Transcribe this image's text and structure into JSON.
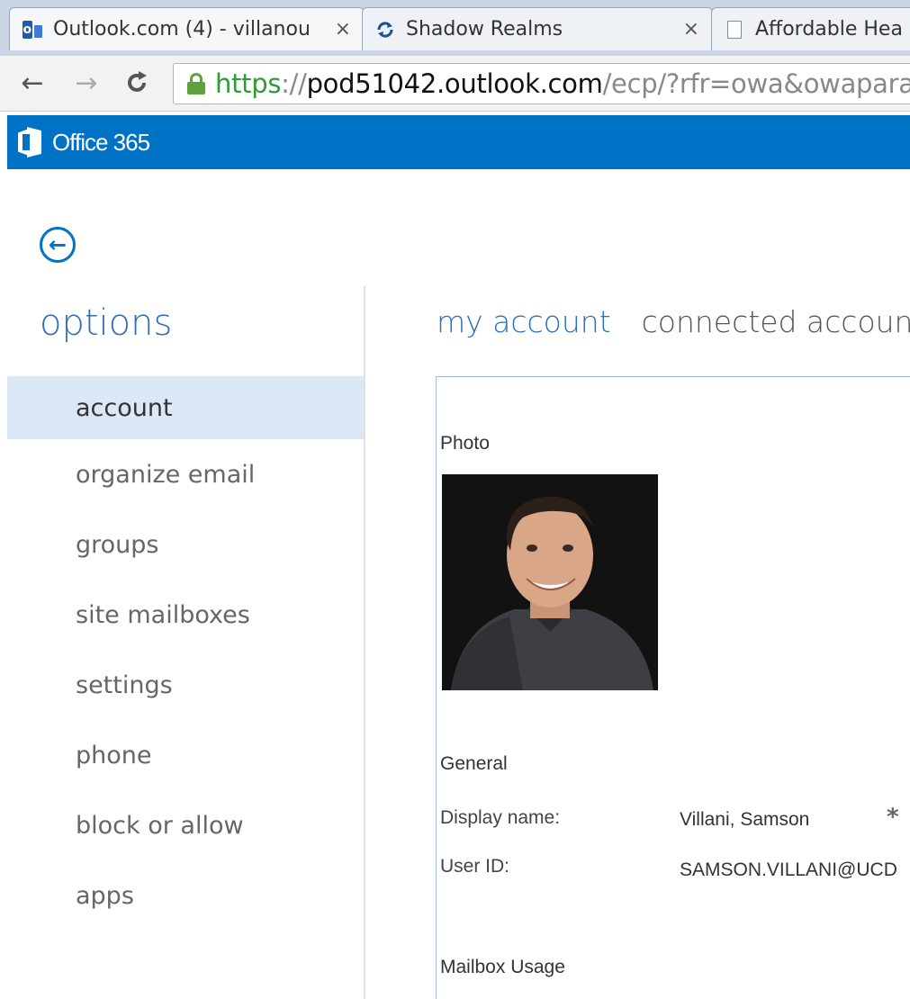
{
  "browser": {
    "tabs": [
      {
        "title": "Outlook.com (4) - villanou",
        "icon": "outlook-icon"
      },
      {
        "title": "Shadow Realms",
        "icon": "sync-icon"
      },
      {
        "title": "Affordable Hea",
        "icon": "document-icon"
      }
    ],
    "close_glyph": "×",
    "url": {
      "scheme": "https",
      "separator": "://",
      "host": "pod51042.outlook.com",
      "path": "/ecp/?rfr=owa&owapara"
    },
    "accent_secure": "#2e9b38"
  },
  "header": {
    "brand": "Office 365",
    "color": "#0072c6"
  },
  "sidebar": {
    "title": "options",
    "items": [
      {
        "label": "account"
      },
      {
        "label": "organize email"
      },
      {
        "label": "groups"
      },
      {
        "label": "site mailboxes"
      },
      {
        "label": "settings"
      },
      {
        "label": "phone"
      },
      {
        "label": "block or allow"
      },
      {
        "label": "apps"
      }
    ],
    "selected": "account"
  },
  "main": {
    "tabs": [
      {
        "label": "my account"
      },
      {
        "label": "connected accounts"
      }
    ],
    "photo_label": "Photo",
    "general_label": "General",
    "fields": [
      {
        "label": "Display name:",
        "value": "Villani, Samson"
      },
      {
        "label": "User ID:",
        "value": "SAMSON.VILLANI@UCD"
      }
    ],
    "required_marker": "*",
    "mailbox_label": "Mailbox Usage"
  }
}
